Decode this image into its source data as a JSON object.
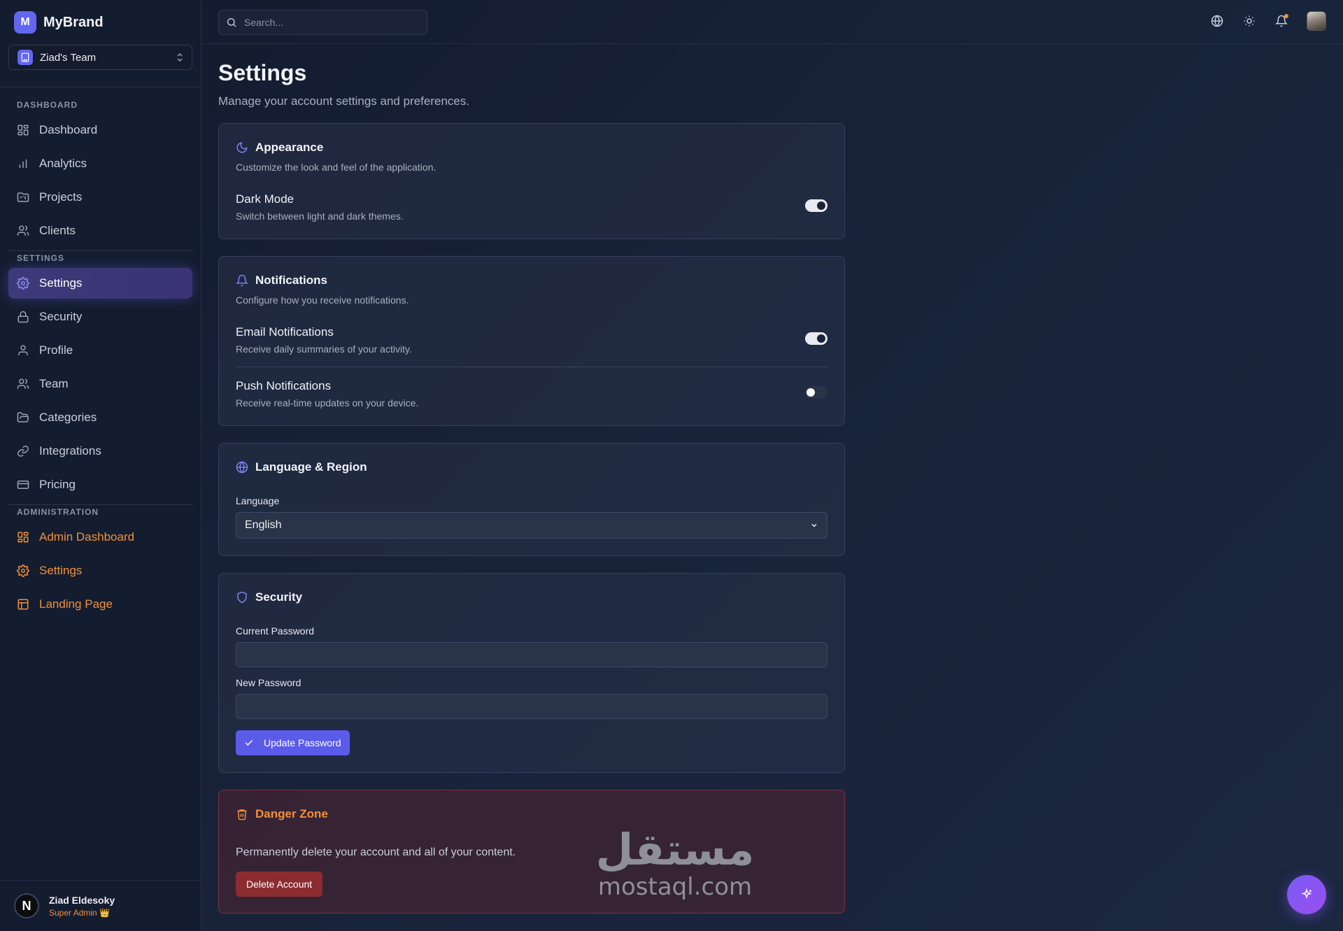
{
  "brand": {
    "logo_letter": "M",
    "name": "MyBrand"
  },
  "team": {
    "name": "Ziad's Team"
  },
  "nav": {
    "dashboard_section": "DASHBOARD",
    "dashboard": "Dashboard",
    "analytics": "Analytics",
    "projects": "Projects",
    "clients": "Clients",
    "settings_section": "SETTINGS",
    "settings": "Settings",
    "security": "Security",
    "profile": "Profile",
    "team": "Team",
    "categories": "Categories",
    "integrations": "Integrations",
    "pricing": "Pricing",
    "admin_section": "ADMINISTRATION",
    "admin_dashboard": "Admin Dashboard",
    "admin_settings": "Settings",
    "landing_page": "Landing Page"
  },
  "user": {
    "avatar_letter": "N",
    "name": "Ziad Eldesoky",
    "role": "Super Admin 👑"
  },
  "search": {
    "placeholder": "Search..."
  },
  "page": {
    "title": "Settings",
    "subtitle": "Manage your account settings and preferences."
  },
  "appearance": {
    "title": "Appearance",
    "description": "Customize the look and feel of the application.",
    "dark_mode_title": "Dark Mode",
    "dark_mode_desc": "Switch between light and dark themes.",
    "dark_mode_on": true
  },
  "notifications": {
    "title": "Notifications",
    "description": "Configure how you receive notifications.",
    "email_title": "Email Notifications",
    "email_desc": "Receive daily summaries of your activity.",
    "email_on": true,
    "push_title": "Push Notifications",
    "push_desc": "Receive real-time updates on your device.",
    "push_on": false
  },
  "language": {
    "title": "Language & Region",
    "label": "Language",
    "value": "English"
  },
  "security": {
    "title": "Security",
    "current_label": "Current Password",
    "new_label": "New Password",
    "button": "Update Password"
  },
  "danger": {
    "title": "Danger Zone",
    "text": "Permanently delete your account and all of your content.",
    "button": "Delete Account"
  },
  "watermark": {
    "arabic": "مستقل",
    "latin": "mostaql.com"
  },
  "colors": {
    "accent": "#6366f1",
    "admin": "#f0913a",
    "danger": "#8a2c30"
  }
}
